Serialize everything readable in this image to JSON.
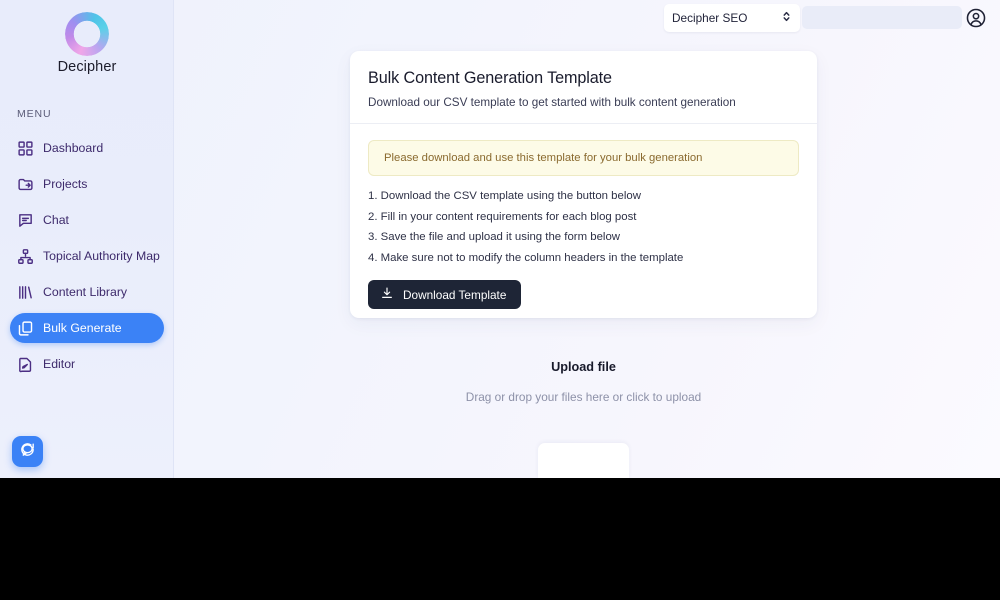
{
  "brand": {
    "name": "Decipher",
    "logo_icon": "decipher-ring-logo",
    "accent_color": "#3b82f6"
  },
  "sidebar": {
    "section_label": "MENU",
    "items": [
      {
        "label": "Dashboard",
        "icon": "grid-icon",
        "active": false
      },
      {
        "label": "Projects",
        "icon": "folder-icon",
        "active": false
      },
      {
        "label": "Chat",
        "icon": "chat-bubble-icon",
        "active": false
      },
      {
        "label": "Topical Authority Map",
        "icon": "hierarchy-icon",
        "active": false
      },
      {
        "label": "Content Library",
        "icon": "library-bars-icon",
        "active": false
      },
      {
        "label": "Bulk Generate",
        "icon": "copy-documents-icon",
        "active": true
      },
      {
        "label": "Editor",
        "icon": "document-pencil-icon",
        "active": false
      }
    ],
    "chat_fab_icon": "chat-bubble-icon"
  },
  "topbar": {
    "project_select_value": "Decipher SEO",
    "project_select_icon": "chevron-up-down-icon",
    "search_placeholder": "",
    "search_value": "",
    "avatar_icon": "user-circle-icon"
  },
  "card": {
    "title": "Bulk Content Generation Template",
    "subtitle": "Download our CSV template to get started with bulk content generation",
    "alert": "Please download and use this template for your bulk generation",
    "steps": [
      "1. Download the CSV template using the button below",
      "2. Fill in your content requirements for each blog post",
      "3. Save the file and upload it using the form below",
      "4. Make sure not to modify the column headers in the template"
    ],
    "download_label": "Download Template",
    "download_icon": "download-icon"
  },
  "upload": {
    "title": "Upload file",
    "hint": "Drag or drop your files here or click to upload"
  },
  "colors": {
    "accent": "#3b82f6",
    "button_dark": "#1e2536",
    "alert_bg": "#fdfbe7",
    "alert_text": "#8a6a2f",
    "sidebar_text": "#3d2a6b"
  }
}
